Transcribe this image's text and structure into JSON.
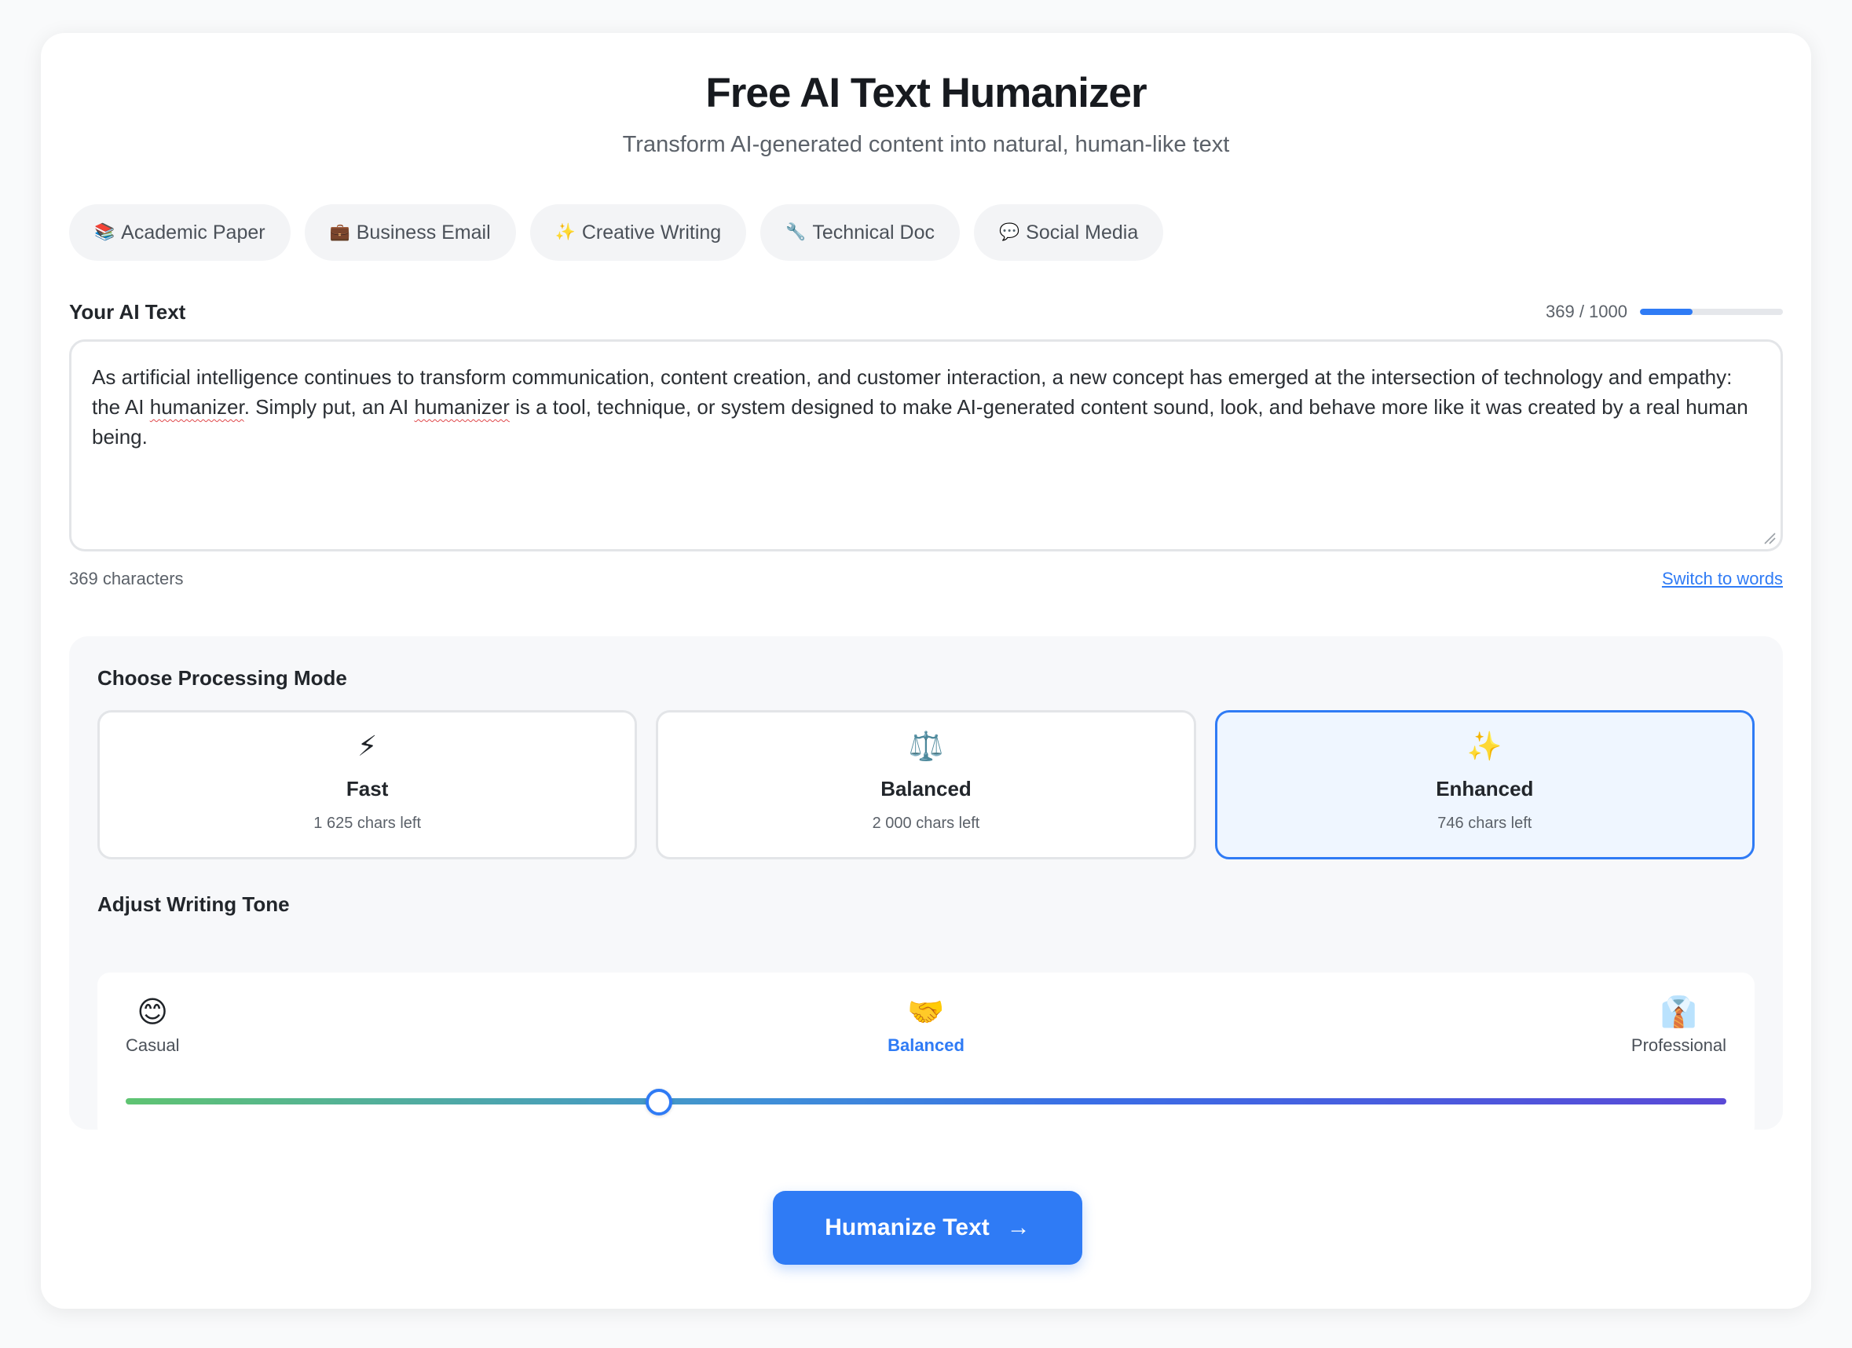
{
  "header": {
    "title": "Free AI Text Humanizer",
    "subtitle": "Transform AI-generated content into natural, human-like text"
  },
  "templates": [
    {
      "icon": "📚",
      "icon_name": "books-icon",
      "label": "Academic Paper"
    },
    {
      "icon": "💼",
      "icon_name": "briefcase-icon",
      "label": "Business Email"
    },
    {
      "icon": "✨",
      "icon_name": "sparkles-icon",
      "label": "Creative Writing"
    },
    {
      "icon": "🔧",
      "icon_name": "wrench-icon",
      "label": "Technical Doc"
    },
    {
      "icon": "💬",
      "icon_name": "speech-bubble-icon",
      "label": "Social Media"
    }
  ],
  "input": {
    "label": "Your AI Text",
    "counter": "369 / 1000",
    "usage_fraction": 0.369,
    "text_part1": "As artificial intelligence continues to transform communication, content creation, and customer interaction, a new concept has emerged at the intersection of technology and empathy: the AI ",
    "text_word1": "humanizer",
    "text_part2": ". Simply put, an AI ",
    "text_word2": "humanizer",
    "text_part3": " is a tool, technique, or system designed to make AI-generated content sound, look, and behave more like it was created by a real human being.",
    "char_count": "369 characters",
    "switch_label": "Switch to words"
  },
  "modes": {
    "label": "Choose Processing Mode",
    "selected": "Enhanced",
    "items": [
      {
        "icon": "⚡",
        "icon_name": "lightning-icon",
        "name": "Fast",
        "sub": "1 625 chars left"
      },
      {
        "icon": "⚖️",
        "icon_name": "scales-icon",
        "name": "Balanced",
        "sub": "2 000 chars left"
      },
      {
        "icon": "✨",
        "icon_name": "sparkles-icon",
        "name": "Enhanced",
        "sub": "746 chars left"
      }
    ]
  },
  "tone": {
    "label": "Adjust Writing Tone",
    "slider_value": 0.333,
    "options": [
      {
        "icon": "😊",
        "icon_name": "smiley-icon",
        "name": "Casual"
      },
      {
        "icon": "🤝",
        "icon_name": "handshake-icon",
        "name": "Balanced"
      },
      {
        "icon": "👔",
        "icon_name": "necktie-icon",
        "name": "Professional"
      }
    ],
    "active": "Balanced"
  },
  "cta": {
    "label": "Humanize Text",
    "arrow": "→"
  },
  "colors": {
    "accent": "#2f7bf5",
    "selected_bg": "#eff6ff",
    "card_bg": "#ffffff",
    "panel_bg": "#f7f8fa"
  }
}
